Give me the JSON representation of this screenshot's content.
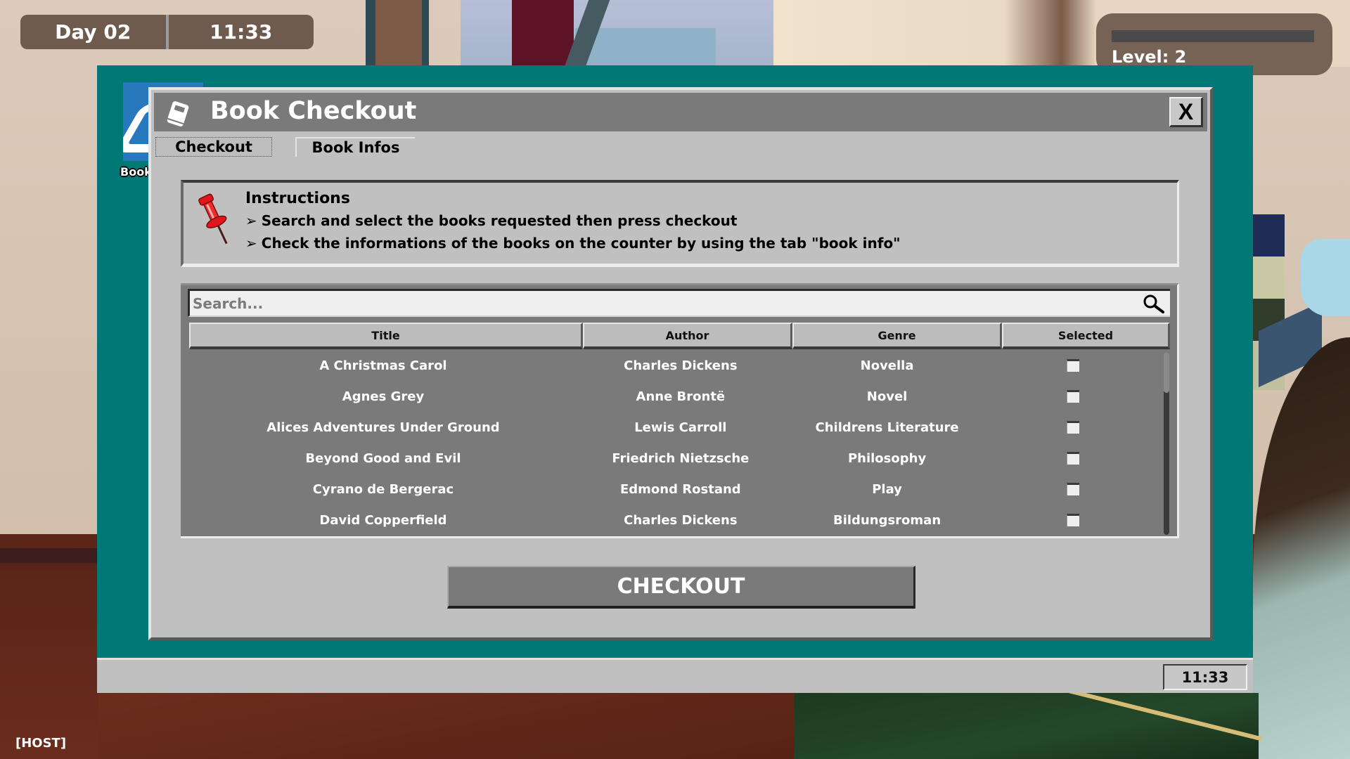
{
  "hud": {
    "day": "Day 02",
    "time": "11:33",
    "level_label": "Level: 2",
    "level_progress": 0,
    "role_tag": "[HOST]"
  },
  "desktop": {
    "icon_label": "Book",
    "icon": "book-app-icon",
    "taskbar_clock": "11:33"
  },
  "window": {
    "title": "Book Checkout",
    "title_icon": "book-icon",
    "close_label": "X",
    "tabs": [
      {
        "label": "Checkout",
        "active": true
      },
      {
        "label": "Book Infos",
        "active": false
      }
    ]
  },
  "instructions": {
    "icon": "pushpin-icon",
    "title": "Instructions",
    "bullet": "➢",
    "lines": [
      "Search and select the books requested then press checkout",
      "Check the informations of the books on the counter by using the tab \"book info\""
    ]
  },
  "search": {
    "placeholder": "Search...",
    "value": "",
    "icon": "search-icon"
  },
  "table": {
    "columns": [
      "Title",
      "Author",
      "Genre",
      "Selected"
    ],
    "rows": [
      {
        "title": "A Christmas Carol",
        "author": "Charles Dickens",
        "genre": "Novella",
        "selected": false
      },
      {
        "title": "Agnes Grey",
        "author": "Anne Brontë",
        "genre": "Novel",
        "selected": false
      },
      {
        "title": "Alices Adventures Under Ground",
        "author": "Lewis Carroll",
        "genre": "Childrens Literature",
        "selected": false
      },
      {
        "title": "Beyond Good and Evil",
        "author": "Friedrich Nietzsche",
        "genre": "Philosophy",
        "selected": false
      },
      {
        "title": "Cyrano de Bergerac",
        "author": "Edmond Rostand",
        "genre": "Play",
        "selected": false
      },
      {
        "title": "David Copperfield",
        "author": "Charles Dickens",
        "genre": "Bildungsroman",
        "selected": false
      }
    ]
  },
  "actions": {
    "checkout_label": "CHECKOUT"
  },
  "colors": {
    "desktop_teal": "#007876",
    "window_gray": "#c0c0c0",
    "titlebar_gray": "#7a7a7a",
    "hud_brown": "#6f5a4e"
  }
}
